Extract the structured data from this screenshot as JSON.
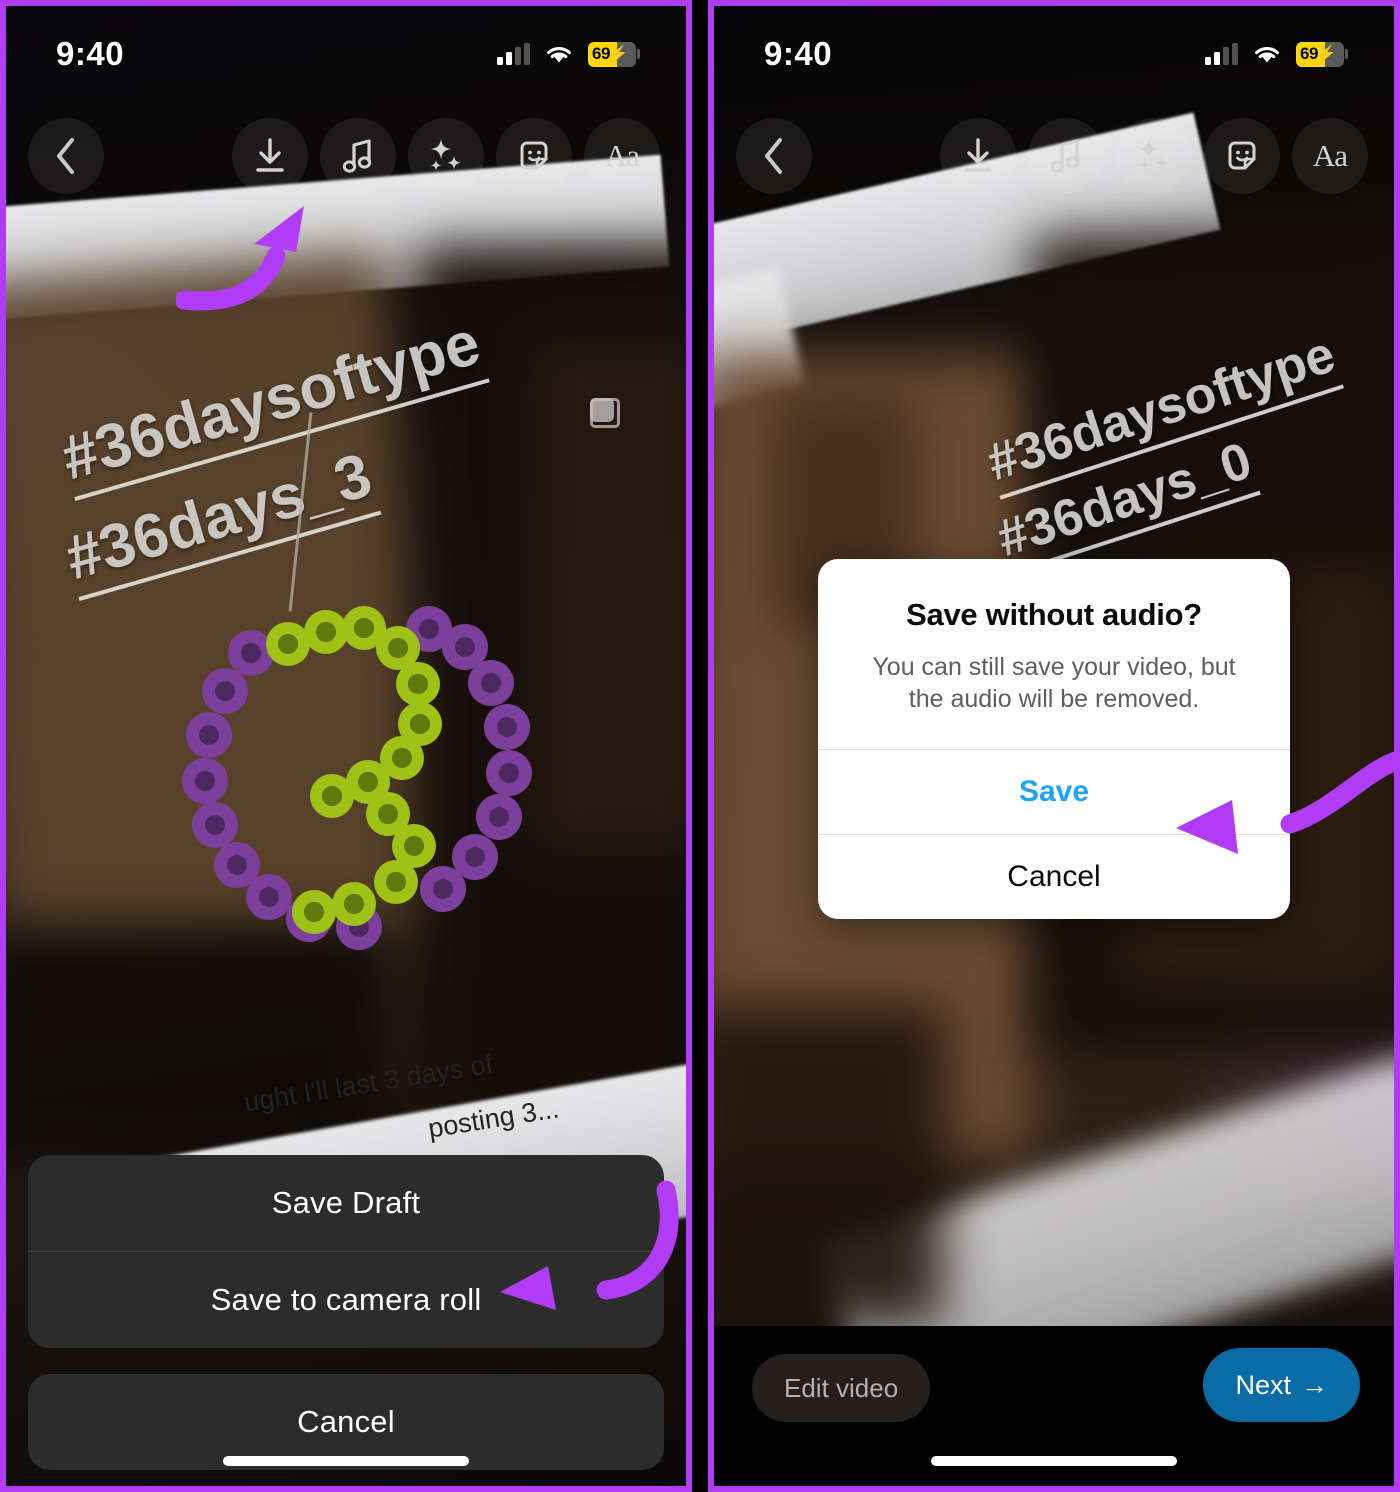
{
  "meta": {
    "accent_purple": "#b13cf5",
    "panel_border": "#b13cf5",
    "alert_save_blue": "#1aa3ff",
    "next_button_blue": "#0a6ca6",
    "sheet_bg": "#2c2c2c",
    "battery_yellow": "#ffd60a"
  },
  "status_bar": {
    "time": "9:40",
    "battery_percent": "69",
    "charging_icon": "⚡",
    "signal_icon": "cellular-signal-icon",
    "wifi_icon": "wifi-icon"
  },
  "toolbar": {
    "back_label": "‹",
    "items": [
      {
        "name": "download-icon",
        "label": "Download"
      },
      {
        "name": "music-note-icon",
        "label": "Music"
      },
      {
        "name": "sparkles-icon",
        "label": "Effects"
      },
      {
        "name": "sticker-icon",
        "label": "Stickers"
      },
      {
        "name": "text-aa-icon",
        "label": "Aa"
      }
    ]
  },
  "left_panel": {
    "photo": {
      "hashtag_line_1": "#36daysoftype",
      "hashtag_line_2": "#36days_3",
      "caption": "ught I'll last 3 days of",
      "caption_2": "posting 3...",
      "carousel_icon": "carousel-stack-icon"
    },
    "action_sheet": {
      "options": [
        {
          "label": "Save Draft",
          "name": "save-draft-option"
        },
        {
          "label": "Save to camera roll",
          "name": "save-to-camera-roll-option"
        }
      ],
      "cancel_label": "Cancel"
    },
    "annotations": [
      {
        "name": "arrow-to-download-icon",
        "target": "download-icon"
      },
      {
        "name": "arrow-to-save-to-camera-roll",
        "target": "save-to-camera-roll-option"
      }
    ]
  },
  "right_panel": {
    "photo": {
      "hashtag_line_1": "#36daysoftype",
      "hashtag_line_2": "#36days_0",
      "carousel_icon": "carousel-stack-icon"
    },
    "alert": {
      "title": "Save without audio?",
      "message": "You can still save your video, but the audio will be removed.",
      "save_label": "Save",
      "cancel_label": "Cancel"
    },
    "bottom_bar": {
      "edit_label": "Edit video",
      "next_label": "Next",
      "next_arrow": "→"
    },
    "annotations": [
      {
        "name": "arrow-to-save-button",
        "target": "alert-save-button"
      }
    ]
  }
}
